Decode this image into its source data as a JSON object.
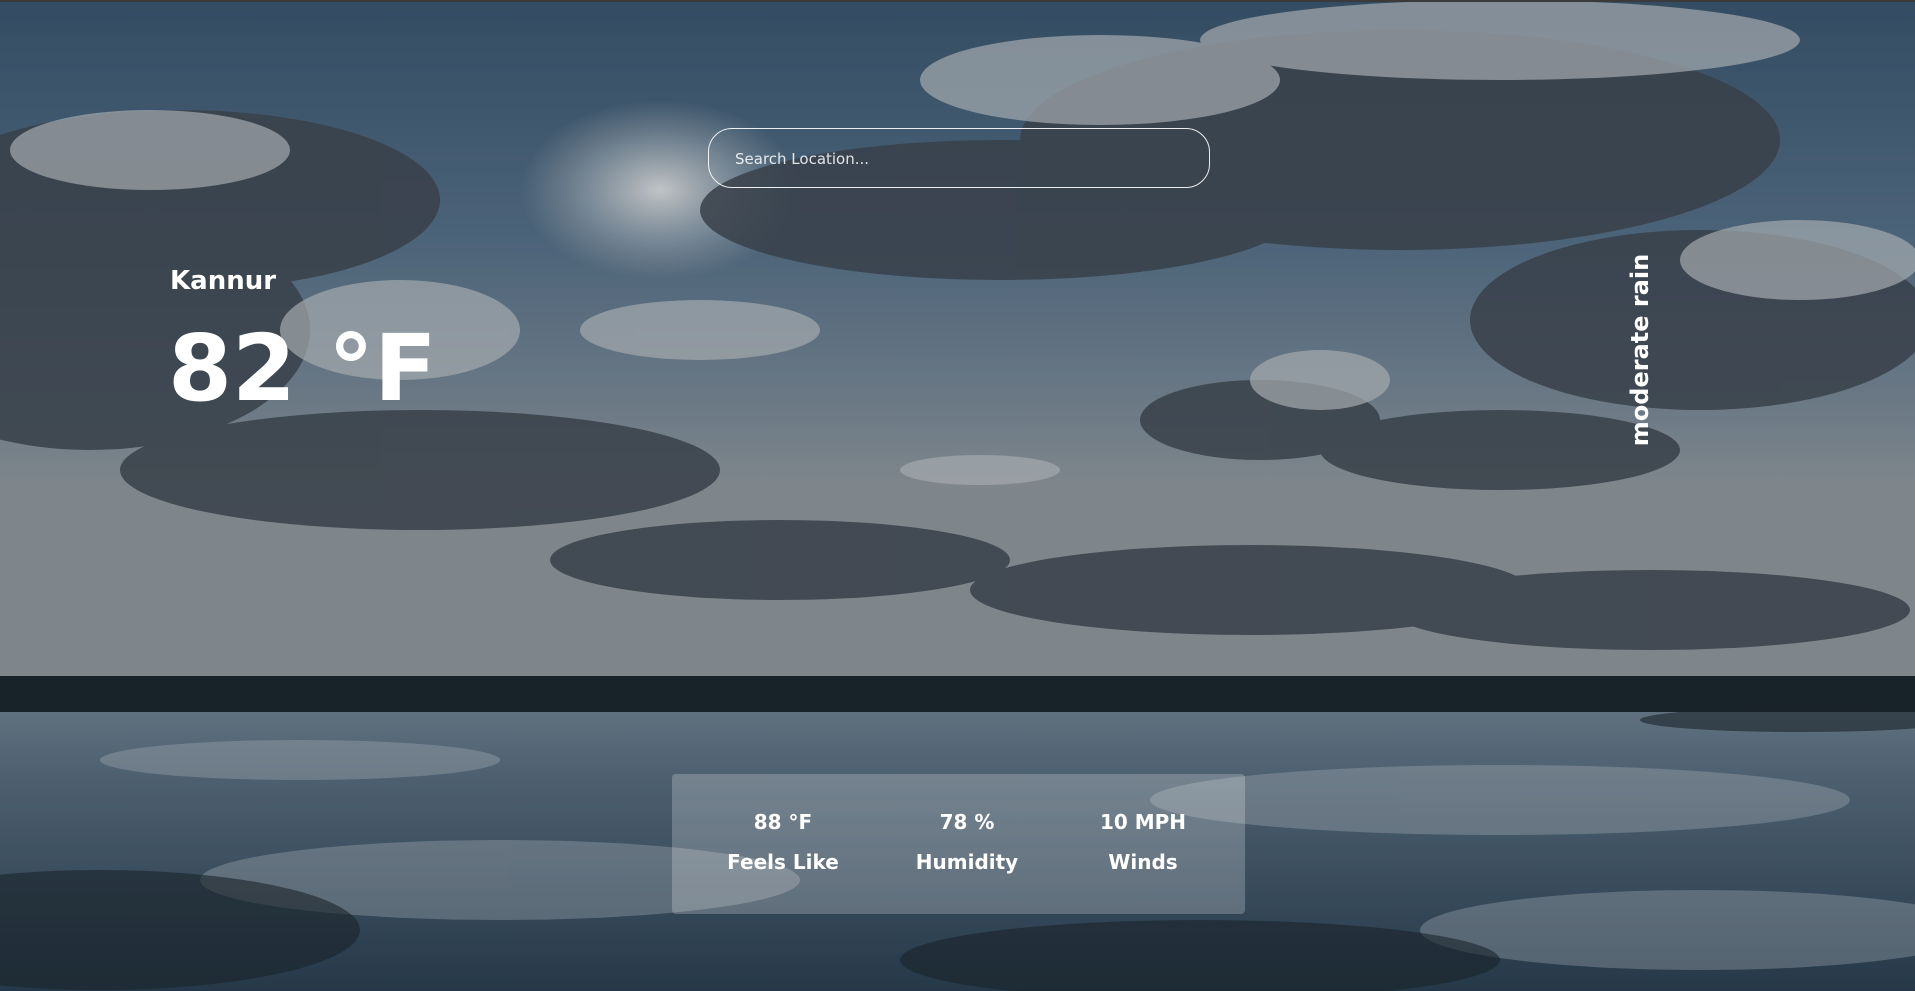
{
  "search": {
    "placeholder": "Search Location..."
  },
  "location": {
    "name": "Kannur"
  },
  "current": {
    "temperature": "82 °F",
    "description": "moderate rain"
  },
  "details": {
    "feels_like_value": "88 °F",
    "feels_like_label": "Feels Like",
    "humidity_value": "78 %",
    "humidity_label": "Humidity",
    "winds_value": "10 MPH",
    "winds_label": "Winds"
  }
}
